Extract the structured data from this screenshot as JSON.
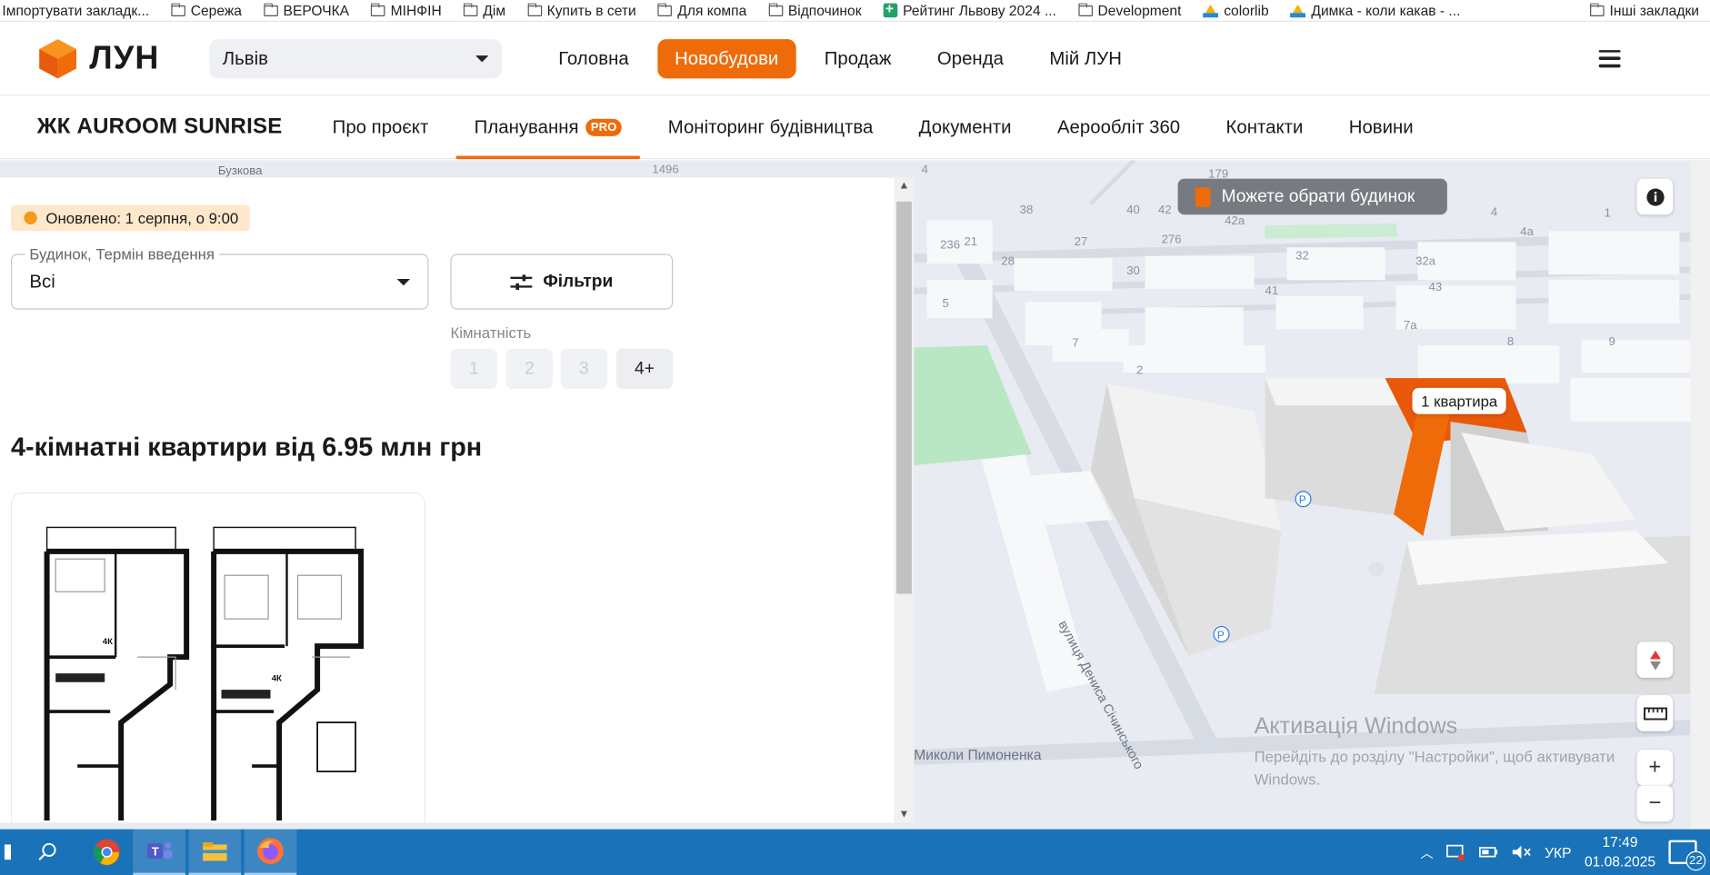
{
  "bookmarks": {
    "items": [
      {
        "label": "Імпортувати закладк...",
        "icon": "none"
      },
      {
        "label": "Сережа",
        "icon": "folder-icon"
      },
      {
        "label": "ВЕРОЧКА",
        "icon": "folder-icon"
      },
      {
        "label": "МІНФІН",
        "icon": "folder-icon"
      },
      {
        "label": "Дім",
        "icon": "folder-icon"
      },
      {
        "label": "Купить в сети",
        "icon": "folder-icon"
      },
      {
        "label": "Для компа",
        "icon": "folder-icon"
      },
      {
        "label": "Відпочинок",
        "icon": "folder-icon"
      },
      {
        "label": "Рейтинг Львову 2024 ...",
        "icon": "sheets-icon"
      },
      {
        "label": "Development",
        "icon": "folder-icon"
      },
      {
        "label": "colorlib",
        "icon": "drive-icon"
      },
      {
        "label": "Димка - коли какав - ...",
        "icon": "drive-icon"
      }
    ],
    "other": "Інші закладки"
  },
  "header": {
    "logo": "ЛУН",
    "city": "Львів",
    "menu": [
      {
        "label": "Головна",
        "active": false
      },
      {
        "label": "Новобудови",
        "active": true
      },
      {
        "label": "Продаж",
        "active": false
      },
      {
        "label": "Оренда",
        "active": false
      },
      {
        "label": "Мій ЛУН",
        "active": false
      }
    ],
    "accent": "#ef6b0a"
  },
  "project": {
    "title": "ЖК AUROOM SUNRISE",
    "tabs": [
      {
        "label": "Про проєкт"
      },
      {
        "label": "Планування",
        "badge": "PRO",
        "active": true
      },
      {
        "label": "Моніторинг будівництва"
      },
      {
        "label": "Документи"
      },
      {
        "label": "Аерообліт 360"
      },
      {
        "label": "Контакти"
      },
      {
        "label": "Новини"
      }
    ]
  },
  "panel": {
    "updated": "Оновлено: 1 серпня, о 9:00",
    "select_label": "Будинок, Термін введення",
    "select_value": "Всі",
    "filters_label": "Фільтри",
    "rooms_label": "Кімнатність",
    "rooms": [
      "1",
      "2",
      "3",
      "4+"
    ],
    "rooms_selected": "4+",
    "heading": "4-кімнатні квартири від 6.95 млн грн"
  },
  "map": {
    "toast": "Можете обрати будинок",
    "tooltip": "1 квартира",
    "street_1": "вулиця Дениса Січинського",
    "street_2": "Миколи Пимоненка",
    "street_3": "Бузкова",
    "labels": [
      "4",
      "1496",
      "179",
      "38",
      "40",
      "42",
      "42a",
      "4",
      "4a",
      "1",
      "236",
      "21",
      "27",
      "276",
      "32",
      "32a",
      "28",
      "30",
      "41",
      "43",
      "5",
      "7a",
      "8",
      "9",
      "7",
      "2"
    ]
  },
  "windows": {
    "activation_title": "Активація Windows",
    "activation_text_1": "Перейдіть до розділу \"Настройки\", щоб активувати",
    "activation_text_2": "Windows.",
    "lang": "УКР",
    "time": "17:49",
    "date": "01.08.2025",
    "notifications": "22"
  }
}
